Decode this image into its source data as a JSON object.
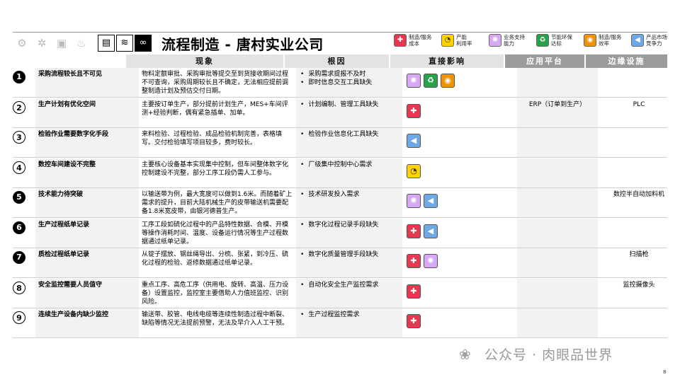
{
  "header": {
    "title": "流程制造 - 唐村实业公司",
    "grey_icons": [
      "robot-arm-icon",
      "gears-icon",
      "machine-icon",
      "flame-icon"
    ],
    "main_icons": [
      {
        "name": "factory-icon",
        "glyph": "▤",
        "selected": false
      },
      {
        "name": "waves-icon",
        "glyph": "≋",
        "selected": false
      },
      {
        "name": "chain-icon",
        "glyph": "∞",
        "selected": true
      }
    ]
  },
  "legend": [
    {
      "label": "制造/服务\n成本",
      "color": "#e8384f",
      "glyph": "✚",
      "cls": "col-red",
      "icon": "cost-icon"
    },
    {
      "label": "产能\n利用率",
      "color": "#ffd200",
      "glyph": "◔",
      "cls": "col-yel",
      "icon": "capacity-icon"
    },
    {
      "label": "业务支持\n能力",
      "color": "#d9a8f5",
      "glyph": "✺",
      "cls": "col-pur",
      "icon": "support-icon"
    },
    {
      "label": "节能环保\n达标",
      "color": "#29a04a",
      "glyph": "♻",
      "cls": "col-grn",
      "icon": "eco-icon"
    },
    {
      "label": "制造/服务\n效率",
      "color": "#f39200",
      "glyph": "◉",
      "cls": "col-ora",
      "icon": "efficiency-icon"
    },
    {
      "label": "产品市场\n竞争力",
      "color": "#6fa8e6",
      "glyph": "◀",
      "cls": "col-blu",
      "icon": "competitiveness-icon"
    }
  ],
  "columns": {
    "phenomenon": "现象",
    "cause": "根因",
    "impact": "直接影响",
    "platform": "应用平台",
    "equipment": "边缘设施"
  },
  "rows": [
    {
      "num": "1",
      "style": "fill",
      "name": "采购流程较长且不可见",
      "phen": "物料定额审批、采购审批等提交至到货接收期间过程不可查询，采购周期较长且不确定，无法相应提前调整制造计划及预估交付日期。",
      "causes": [
        "采购需求提报不及时",
        "即时信息交互工具缺失"
      ],
      "impacts": [
        "col-pur",
        "col-grn",
        "col-ora"
      ],
      "platform": "",
      "equipment": ""
    },
    {
      "num": "2",
      "style": "out",
      "name": "生产计划有优化空间",
      "phen": "主要按订单生产，部分提前计划生产，MES+车间评测+经验判断，偶有紧急插单、加单。",
      "causes": [
        "计划编制、管理工具缺失"
      ],
      "impacts": [
        "col-red"
      ],
      "platform": "ERP（订单到生产）",
      "equipment": "PLC"
    },
    {
      "num": "3",
      "style": "out",
      "name": "检验作业需要数字化手段",
      "phen": "来料检验、过程检验、成品检验机制完善，表格填写。交付检验填写项目较多，费时较长。",
      "causes": [
        "检验作业信息化工具缺失"
      ],
      "impacts": [
        "col-blu"
      ],
      "platform": "",
      "equipment": ""
    },
    {
      "num": "4",
      "style": "out",
      "name": "数控车间建设不完整",
      "phen": "主要核心设备基本实现集中控制，但车间整体数字化控制建设不完整，部分工序工段仍需人工参与。",
      "causes": [
        "厂级集中控制中心需求"
      ],
      "impacts": [
        "col-yel"
      ],
      "platform": "",
      "equipment": ""
    },
    {
      "num": "5",
      "style": "fill",
      "name": "技术能力待突破",
      "phen": "以输送带为例，最大宽度可以做到1.6米。而随着矿上需求的提升，目前大陆机械生产的皮带输送机需要配备1.8米宽皮带，由银河德普生产。",
      "causes": [
        "技术研发投入需求"
      ],
      "impacts": [
        "col-pur",
        "col-blu"
      ],
      "platform": "",
      "equipment": "数控半自动加料机"
    },
    {
      "num": "6",
      "style": "fill",
      "name": "生产过程纸单记录",
      "phen": "工序工段如硫化过程中的产品特性数据、合模、开模等操作消耗时间、温度、设备运行情况等生产过程数据通过纸单记录。",
      "causes": [
        "数字化过程记录手段缺失"
      ],
      "impacts": [
        "col-red",
        "col-blu"
      ],
      "platform": "",
      "equipment": ""
    },
    {
      "num": "7",
      "style": "fill",
      "name": "质检过程纸单记录",
      "phen": "从锭子摆放、钢丝绳导出、分梳、张紧，到冷压、硫化过程的检验、返修数据通过纸单记录。",
      "causes": [
        "数字化质量管理手段缺失"
      ],
      "impacts": [
        "col-red",
        "col-pur"
      ],
      "platform": "",
      "equipment": "扫描枪"
    },
    {
      "num": "8",
      "style": "out",
      "name": "安全监控需要人员值守",
      "phen": "重点工序、高危工序（供用电、旋转、高温、压力设备）设置监控，监控室主要借助人力值班监控、识别风险。",
      "causes": [
        "自动化安全生产监控需求"
      ],
      "impacts": [
        "col-red"
      ],
      "platform": "",
      "equipment": "监控摄像头"
    },
    {
      "num": "9",
      "style": "out",
      "name": "连续生产设备内缺少监控",
      "phen": "输送带、胶管、电线电缆等连续性制造过程中断裂、缺陷等情况无法提前预警，无法及早介入人工干预。",
      "causes": [
        "生产过程监控需求"
      ],
      "impacts": [
        "col-red"
      ],
      "platform": "",
      "equipment": ""
    }
  ],
  "watermark": "公众号 · 肉眼品世界",
  "page_number": "8"
}
